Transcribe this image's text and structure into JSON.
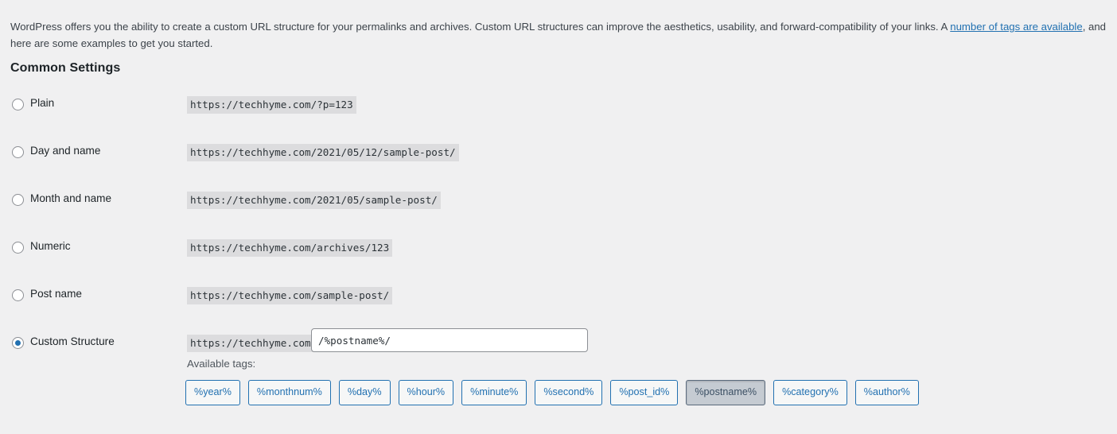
{
  "intro": {
    "text_before_link": "WordPress offers you the ability to create a custom URL structure for your permalinks and archives. Custom URL structures can improve the aesthetics, usability, and forward-compatibility of your links. A ",
    "link_text": "number of tags are available",
    "text_after_link": ", and here are some examples to get you started."
  },
  "section": {
    "heading": "Common Settings"
  },
  "options": [
    {
      "id": "plain",
      "label": "Plain",
      "example": "https://techhyme.com/?p=123",
      "selected": false
    },
    {
      "id": "day-and-name",
      "label": "Day and name",
      "example": "https://techhyme.com/2021/05/12/sample-post/",
      "selected": false
    },
    {
      "id": "month-and-name",
      "label": "Month and name",
      "example": "https://techhyme.com/2021/05/sample-post/",
      "selected": false
    },
    {
      "id": "numeric",
      "label": "Numeric",
      "example": "https://techhyme.com/archives/123",
      "selected": false
    },
    {
      "id": "post-name",
      "label": "Post name",
      "example": "https://techhyme.com/sample-post/",
      "selected": false
    }
  ],
  "custom_structure": {
    "label": "Custom Structure",
    "site_prefix": "https://techhyme.com",
    "input_value": "/%postname%/",
    "available_tags_label": "Available tags:",
    "tags": [
      {
        "label": "%year%",
        "active": false
      },
      {
        "label": "%monthnum%",
        "active": false
      },
      {
        "label": "%day%",
        "active": false
      },
      {
        "label": "%hour%",
        "active": false
      },
      {
        "label": "%minute%",
        "active": false
      },
      {
        "label": "%second%",
        "active": false
      },
      {
        "label": "%post_id%",
        "active": false
      },
      {
        "label": "%postname%",
        "active": true
      },
      {
        "label": "%category%",
        "active": false
      },
      {
        "label": "%author%",
        "active": false
      }
    ]
  },
  "colors": {
    "page_background": "#f0f0f1",
    "link": "#2271b1",
    "radio_accent": "#2271b1",
    "code_chip_background": "#dcdcde",
    "tag_border": "#2271b1",
    "tag_active_background": "#c5cbd2"
  }
}
